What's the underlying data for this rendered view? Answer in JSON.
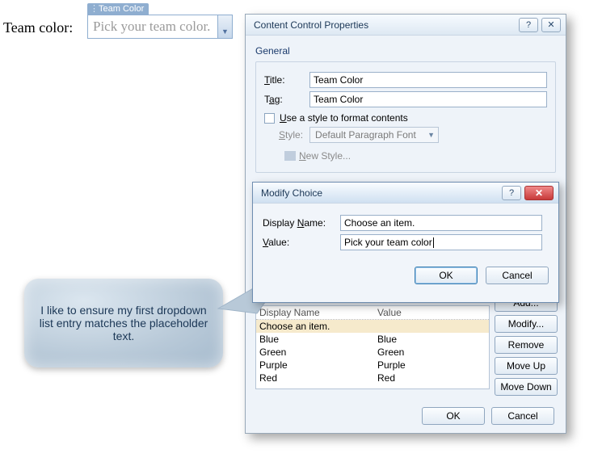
{
  "doc": {
    "label": "Team color:",
    "cc_tab": "Team Color",
    "cc_placeholder": "Pick your team color."
  },
  "dlg": {
    "title": "Content Control Properties",
    "general_label": "General",
    "title_label": "Title:",
    "title_value": "Team Color",
    "tag_label": "Tag:",
    "tag_value": "Team Color",
    "use_style": "Use a style to format contents",
    "style_label": "Style:",
    "style_value": "Default Paragraph Font",
    "new_style": "New Style...",
    "head_name": "Display Name",
    "head_value": "Value",
    "rows": [
      {
        "name": "Choose an item.",
        "value": ""
      },
      {
        "name": "Blue",
        "value": "Blue"
      },
      {
        "name": "Green",
        "value": "Green"
      },
      {
        "name": "Purple",
        "value": "Purple"
      },
      {
        "name": "Red",
        "value": "Red"
      }
    ],
    "btn_add": "Add...",
    "btn_modify": "Modify...",
    "btn_remove": "Remove",
    "btn_moveup": "Move Up",
    "btn_movedown": "Move Down",
    "btn_ok": "OK",
    "btn_cancel": "Cancel"
  },
  "sub": {
    "title": "Modify Choice",
    "display_label": "Display Name:",
    "display_value": "Choose an item.",
    "value_label": "Value:",
    "value_value": "Pick your team color",
    "ok": "OK",
    "cancel": "Cancel"
  },
  "callout": {
    "text": "I like to ensure my first dropdown list entry matches the placeholder text."
  },
  "glyph": {
    "help": "?",
    "close": "✕",
    "x_white": "✕",
    "tri": "▼"
  }
}
